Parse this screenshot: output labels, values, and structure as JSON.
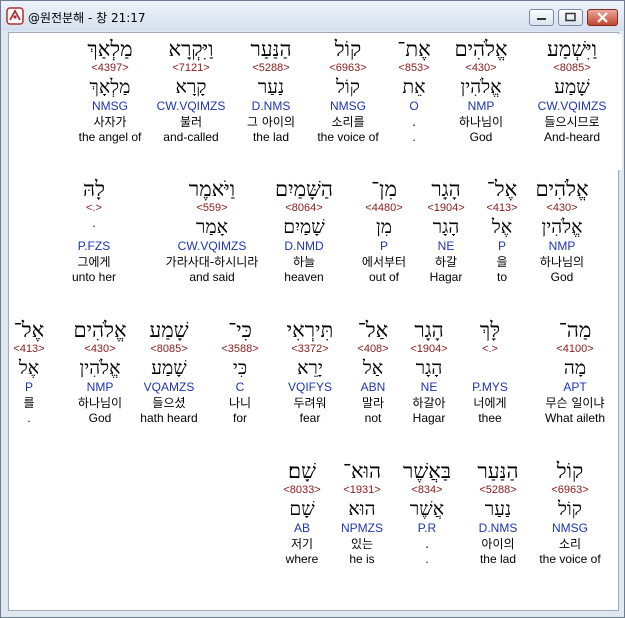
{
  "window": {
    "title": "@원전분해 - 창 21:17",
    "buttons": {
      "minimize": "minimize",
      "maximize": "maximize",
      "close": "close"
    }
  },
  "rows": [
    {
      "words": [
        {
          "heb": "וַיִּשְׁמַע",
          "strong": "<8085>",
          "root": "שָׁמַע",
          "morph": "CW.VQIMZS",
          "kor": "들으시므로",
          "eng": "And-heard",
          "highlight": true
        },
        {
          "heb": "אֱלֹהִים",
          "strong": "<430>",
          "root": "אֱלֹהִין",
          "morph": "NMP",
          "kor": "하나님이",
          "eng": "God"
        },
        {
          "heb": "אֶת־",
          "strong": "<853>",
          "root": "אֵת",
          "morph": "O",
          "kor": ".",
          "eng": "."
        },
        {
          "heb": "קוֹל",
          "strong": "<6963>",
          "root": "קוֹל",
          "morph": "NMSG",
          "kor": "소리를",
          "eng": "the voice of"
        },
        {
          "heb": "הַנַּעַר",
          "strong": "<5288>",
          "root": "נַעַר",
          "morph": "D.NMS",
          "kor": "그 아이의",
          "eng": "the lad"
        },
        {
          "heb": "וַיִּקְרָא",
          "strong": "<7121>",
          "root": "קָרָא",
          "morph": "CW.VQIMZS",
          "kor": "불러",
          "eng": "and-called"
        },
        {
          "heb": "מַלְאַךְ",
          "strong": "<4397>",
          "root": "מַלְאָךְ",
          "morph": "NMSG",
          "kor": "사자가",
          "eng": "the angel of"
        }
      ]
    },
    {
      "words": [
        {
          "heb": "אֱלֹהִים",
          "strong": "<430>",
          "root": "אֱלֹהִין",
          "morph": "NMP",
          "kor": "하나님의",
          "eng": "God"
        },
        {
          "heb": "אֶל־",
          "strong": "<413>",
          "root": "אֶל",
          "morph": "P",
          "kor": "을",
          "eng": "to"
        },
        {
          "heb": "הָגָר",
          "strong": "<1904>",
          "root": "הָגָר",
          "morph": "NE",
          "kor": "하갈",
          "eng": "Hagar"
        },
        {
          "heb": "מִן־",
          "strong": "<4480>",
          "root": "מִן",
          "morph": "P",
          "kor": "에서부터",
          "eng": "out of"
        },
        {
          "heb": "הַשָּׁמַיִם",
          "strong": "<8064>",
          "root": "שָׁמַיִם",
          "morph": "D.NMD",
          "kor": "하늘",
          "eng": "heaven"
        },
        {
          "heb": "וַיֹּאמֶר",
          "strong": "<559>",
          "root": "אָמַר",
          "morph": "CW.VQIMZS",
          "kor": "가라사대-하시니라",
          "eng": "and said"
        },
        {
          "heb": "לָהּ",
          "strong": "<.>",
          "root": "ּ",
          "morph": "P.FZS",
          "kor": "그에게",
          "eng": "unto her"
        }
      ]
    },
    {
      "words": [
        {
          "heb": "מַה־",
          "strong": "<4100>",
          "root": "מָה",
          "morph": "APT",
          "kor": "무슨 일이냐",
          "eng": "What aileth"
        },
        {
          "heb": "לָּךְ",
          "strong": "<.>",
          "root": "",
          "morph": "P.MYS",
          "kor": "너에게",
          "eng": "thee"
        },
        {
          "heb": "הָגָר",
          "strong": "<1904>",
          "root": "הָגָר",
          "morph": "NE",
          "kor": "하갈아",
          "eng": "Hagar"
        },
        {
          "heb": "אַל־",
          "strong": "<408>",
          "root": "אַל",
          "morph": "ABN",
          "kor": "말라",
          "eng": "not"
        },
        {
          "heb": "תִּירְאִי",
          "strong": "<3372>",
          "root": "יָרֵא",
          "morph": "VQIFYS",
          "kor": "두려워",
          "eng": "fear"
        },
        {
          "heb": "כִּי־",
          "strong": "<3588>",
          "root": "כִּי",
          "morph": "C",
          "kor": "나니",
          "eng": "for"
        },
        {
          "heb": "שָׁמַע",
          "strong": "<8085>",
          "root": "שָׁמַע",
          "morph": "VQAMZS",
          "kor": "들으셨",
          "eng": "hath heard"
        },
        {
          "heb": "אֱלֹהִים",
          "strong": "<430>",
          "root": "אֱלֹהִין",
          "morph": "NMP",
          "kor": "하나님이",
          "eng": "God"
        },
        {
          "heb": "אֶל־",
          "strong": "<413>",
          "root": "אֶל",
          "morph": "P",
          "kor": "를",
          "eng": "."
        }
      ]
    },
    {
      "words": [
        {
          "heb": "קוֹל",
          "strong": "<6963>",
          "root": "קוֹל",
          "morph": "NMSG",
          "kor": "소리",
          "eng": "the voice of"
        },
        {
          "heb": "הַנַּעַר",
          "strong": "<5288>",
          "root": "נַעַר",
          "morph": "D.NMS",
          "kor": "아이의",
          "eng": "the lad"
        },
        {
          "heb": "בַּאֲשֶׁר",
          "strong": "<834>",
          "root": "אֲשֶׁר",
          "morph": "P.R",
          "kor": ".",
          "eng": "."
        },
        {
          "heb": "הוּא־",
          "strong": "<1931>",
          "root": "הוּא",
          "morph": "NPMZS",
          "kor": "있는",
          "eng": "he is"
        },
        {
          "heb": "שָׁם׃",
          "strong": "<8033>",
          "root": "שָׁם",
          "morph": "AB",
          "kor": "저기",
          "eng": "where"
        }
      ]
    }
  ]
}
